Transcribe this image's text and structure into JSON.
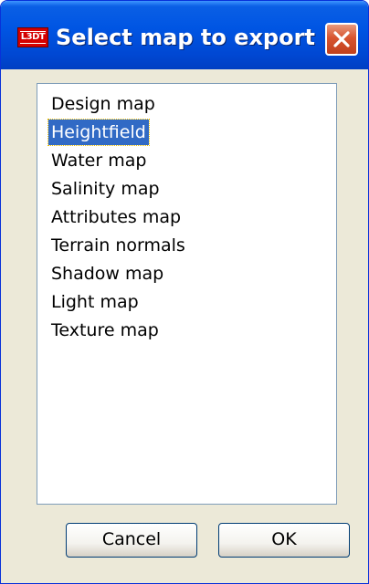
{
  "window": {
    "title": "Select map to export",
    "icon_text": "L3DT",
    "icon": "l3dt-app-icon",
    "close_icon": "close-icon"
  },
  "list": {
    "items": [
      {
        "label": "Design map",
        "selected": false
      },
      {
        "label": "Heightfield",
        "selected": true
      },
      {
        "label": "Water map",
        "selected": false
      },
      {
        "label": "Salinity map",
        "selected": false
      },
      {
        "label": "Attributes map",
        "selected": false
      },
      {
        "label": "Terrain normals",
        "selected": false
      },
      {
        "label": "Shadow map",
        "selected": false
      },
      {
        "label": "Light map",
        "selected": false
      },
      {
        "label": "Texture map",
        "selected": false
      }
    ]
  },
  "buttons": {
    "cancel": "Cancel",
    "ok": "OK"
  },
  "colors": {
    "titlebar": "#0055e3",
    "selection": "#316ac5",
    "close_button": "#d8542f",
    "dialog_face": "#ece9d8"
  }
}
